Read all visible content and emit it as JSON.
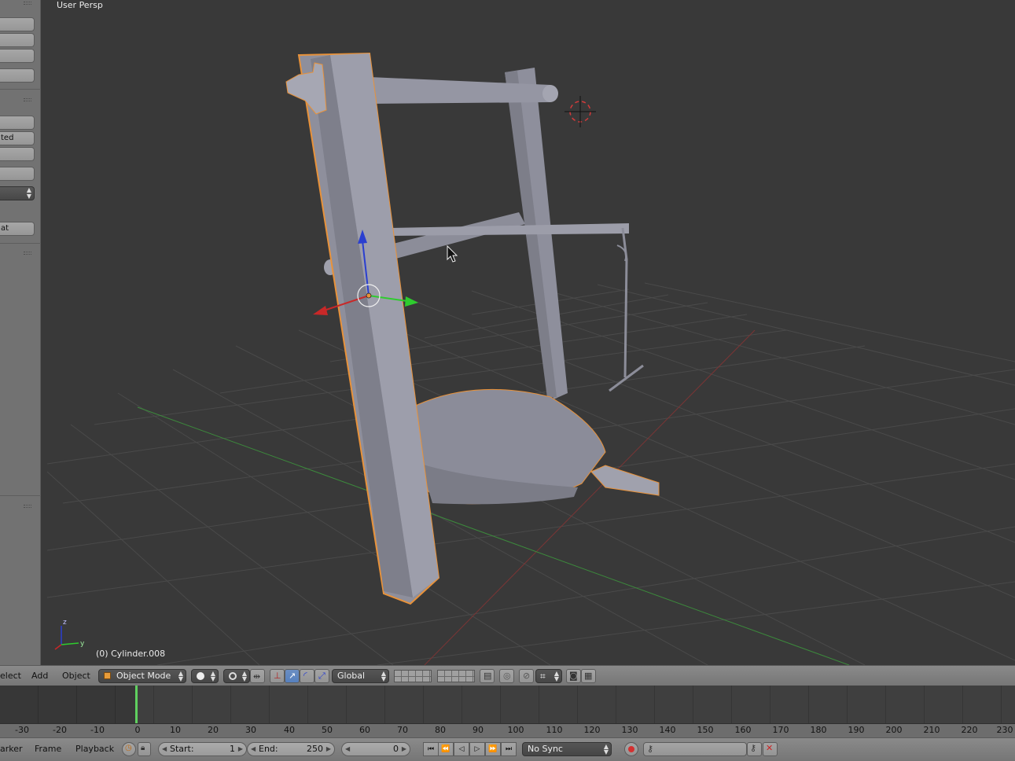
{
  "viewport": {
    "view_name": "User Persp",
    "active_object": "(0) Cylinder.008",
    "axis_labels": {
      "x": "x",
      "y": "y",
      "z": "z"
    }
  },
  "toolshelf": {
    "partial_labels": [
      "ted",
      "at"
    ]
  },
  "view_header": {
    "menus": [
      "elect",
      "Add",
      "Object"
    ],
    "mode": "Object Mode",
    "transform_orientation": "Global",
    "icons": [
      "object-mode-cube-icon",
      "viewport-shading-sphere-icon",
      "pivot-point-icon",
      "manipulator-axes-icon",
      "translate-arrow-icon",
      "rotate-arc-icon",
      "scale-icon",
      "layers-grid-icon",
      "proportional-edit-icon",
      "snap-magnet-icon",
      "render-camera-icon",
      "clapper-icon"
    ]
  },
  "timeline": {
    "current_frame_marker": 0,
    "ruler_ticks": [
      "-30",
      "-20",
      "-10",
      "0",
      "10",
      "20",
      "30",
      "40",
      "50",
      "60",
      "70",
      "80",
      "90",
      "100",
      "110",
      "120",
      "130",
      "140",
      "150",
      "160",
      "170",
      "180",
      "190",
      "200",
      "210",
      "220",
      "230"
    ]
  },
  "timeline_header": {
    "menus": [
      "arker",
      "Frame",
      "Playback"
    ],
    "start_label": "Start:",
    "start_value": "1",
    "end_label": "End:",
    "end_value": "250",
    "current_frame": "0",
    "sync_mode": "No Sync"
  },
  "colors": {
    "viewport_bg": "#393939",
    "selection_outline": "#e8923a",
    "x_axis": "#c82828",
    "y_axis": "#2ecc2e",
    "z_axis": "#2a3fd0",
    "frame_cursor": "#5fd05f",
    "active_button": "#5680be"
  }
}
